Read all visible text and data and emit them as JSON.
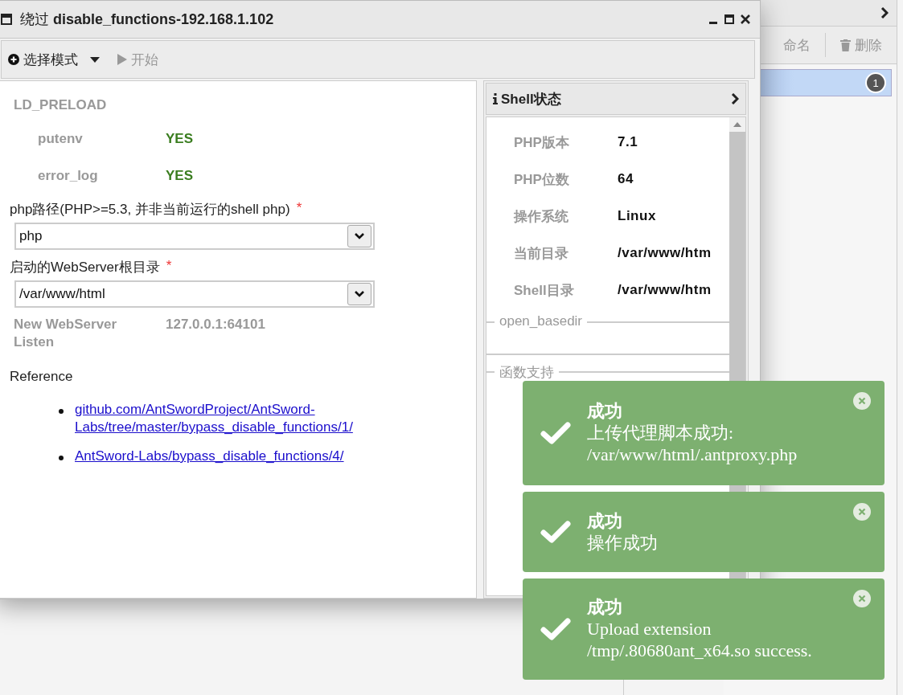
{
  "background": {
    "toolbar": [
      "命名",
      "删除"
    ],
    "list_badge": "1"
  },
  "window": {
    "title_prefix": "绕过",
    "title": "disable_functions-192.168.1.102"
  },
  "toolbar": {
    "mode_button": "选择模式",
    "start_button": "开始",
    "start_disabled": true
  },
  "form": {
    "section": "LD_PRELOAD",
    "checks": [
      {
        "name": "putenv",
        "value": "YES"
      },
      {
        "name": "error_log",
        "value": "YES"
      }
    ],
    "fields": [
      {
        "label": "php路径(PHP>=5.3, 并非当前运行的shell php)",
        "required_mark": "*",
        "value": "php"
      },
      {
        "label": "启动的WebServer根目录",
        "required_mark": "*",
        "value": "/var/www/html"
      }
    ],
    "listen": {
      "label": "New WebServer Listen",
      "value": "127.0.0.1:64101"
    },
    "reference": {
      "title": "Reference",
      "links": [
        "github.com/AntSwordProject/AntSword-Labs/tree/master/bypass_disable_functions/1/",
        "AntSword-Labs/bypass_disable_functions/4/"
      ]
    }
  },
  "shell_panel": {
    "title": "Shell状态",
    "info": [
      {
        "label": "PHP版本",
        "value": "7.1"
      },
      {
        "label": "PHP位数",
        "value": "64"
      },
      {
        "label": "操作系统",
        "value": "Linux"
      },
      {
        "label": "当前目录",
        "value": "/var/www/htm"
      },
      {
        "label": "Shell目录",
        "value": "/var/www/htm"
      }
    ],
    "open_basedir_legend": "open_basedir",
    "functions_legend": "函数支持"
  },
  "notifications": [
    {
      "title": "成功",
      "message": "上传代理脚本成功: /var/www/html/.antproxy.php"
    },
    {
      "title": "成功",
      "message": "操作成功"
    },
    {
      "title": "成功",
      "message": "Upload extension /tmp/.80680ant_x64.so success."
    }
  ]
}
